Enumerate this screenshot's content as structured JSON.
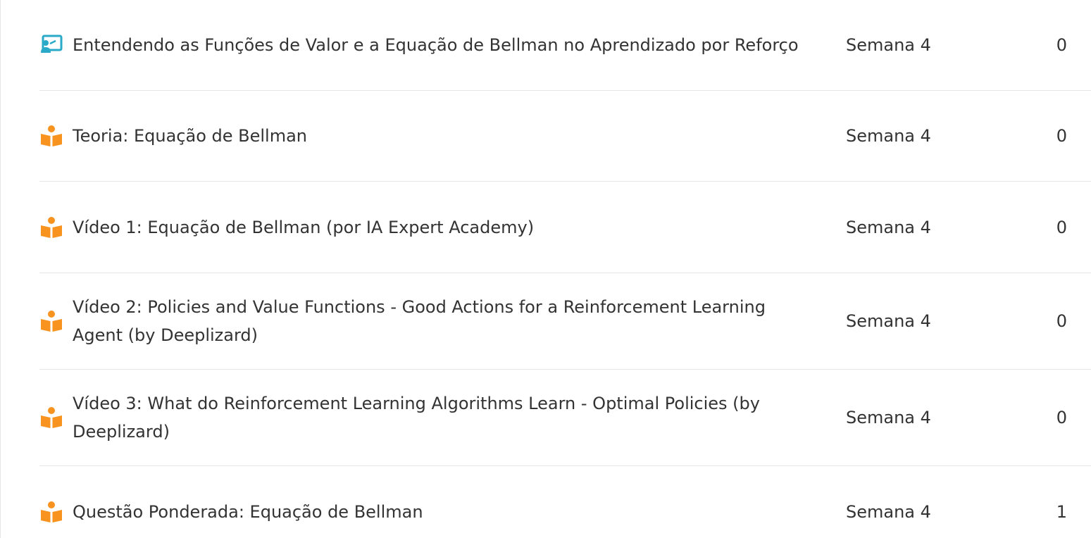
{
  "rows": [
    {
      "icon": "presentation-icon",
      "title": "Entendendo as Funções de Valor e a Equação de Bellman no Aprendizado por Reforço",
      "week": "Semana 4",
      "count": "0"
    },
    {
      "icon": "book-reader-icon",
      "title": "Teoria: Equação de Bellman",
      "week": "Semana 4",
      "count": "0"
    },
    {
      "icon": "book-reader-icon",
      "title": "Vídeo 1: Equação de Bellman (por IA Expert Academy)",
      "week": "Semana 4",
      "count": "0"
    },
    {
      "icon": "book-reader-icon",
      "title": "Vídeo 2: Policies and Value Functions - Good Actions for a Reinforcement Learning Agent (by Deeplizard)",
      "week": "Semana 4",
      "count": "0"
    },
    {
      "icon": "book-reader-icon",
      "title": "Vídeo 3: What do Reinforcement Learning Algorithms Learn - Optimal Policies (by Deeplizard)",
      "week": "Semana 4",
      "count": "0"
    },
    {
      "icon": "book-reader-icon",
      "title": "Questão Ponderada: Equação de Bellman",
      "week": "Semana 4",
      "count": "1"
    }
  ],
  "colors": {
    "presentation_icon": "#2aa9c9",
    "reader_icon": "#f7931e",
    "text": "#333333",
    "divider": "#e6e6e6"
  }
}
